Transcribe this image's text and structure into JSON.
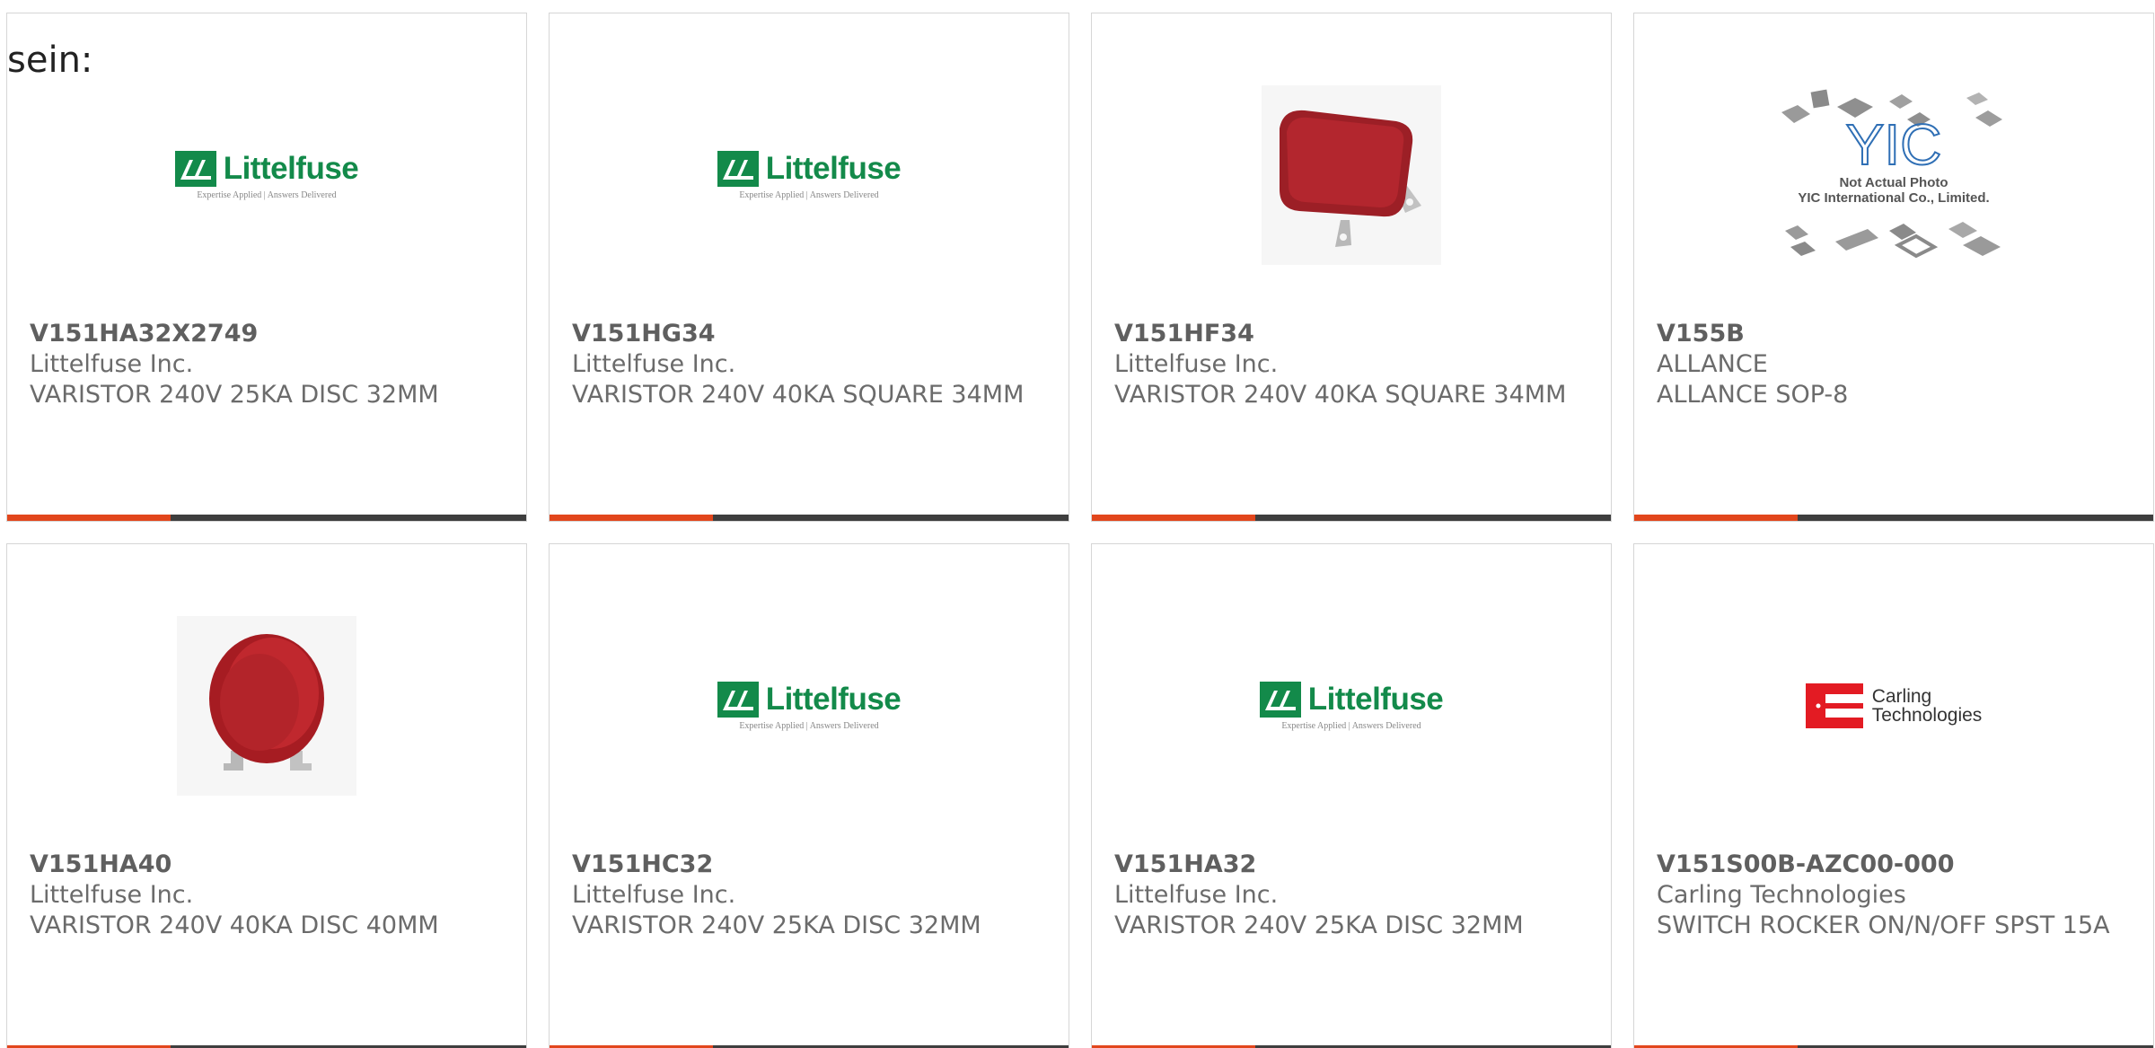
{
  "intro_text": "sein:",
  "colors": {
    "accent": "#e2461c",
    "bar": "#3e3e3e",
    "littelfuse_green": "#138a4a",
    "carling_red": "#e31b23"
  },
  "products": [
    {
      "part": "V151HA32X2749",
      "manufacturer": "Littelfuse Inc.",
      "description": "VARISTOR 240V 25KA DISC 32MM",
      "image": "littelfuse-logo"
    },
    {
      "part": "V151HG34",
      "manufacturer": "Littelfuse Inc.",
      "description": "VARISTOR 240V 40KA SQUARE 34MM",
      "image": "littelfuse-logo"
    },
    {
      "part": "V151HF34",
      "manufacturer": "Littelfuse Inc.",
      "description": "VARISTOR 240V 40KA SQUARE 34MM",
      "image": "square-varistor-photo"
    },
    {
      "part": "V155B",
      "manufacturer": "ALLANCE",
      "description": "ALLANCE SOP-8",
      "image": "yic-placeholder"
    },
    {
      "part": "V151HA40",
      "manufacturer": "Littelfuse Inc.",
      "description": "VARISTOR 240V 40KA DISC 40MM",
      "image": "disc-varistor-photo"
    },
    {
      "part": "V151HC32",
      "manufacturer": "Littelfuse Inc.",
      "description": "VARISTOR 240V 25KA DISC 32MM",
      "image": "littelfuse-logo"
    },
    {
      "part": "V151HA32",
      "manufacturer": "Littelfuse Inc.",
      "description": "VARISTOR 240V 25KA DISC 32MM",
      "image": "littelfuse-logo"
    },
    {
      "part": "V151S00B-AZC00-000",
      "manufacturer": "Carling Technologies",
      "description": "SWITCH ROCKER ON/N/OFF SPST 15A",
      "image": "carling-logo"
    }
  ],
  "logos": {
    "littelfuse_name": "Littelfuse",
    "littelfuse_tagline": "Expertise Applied | Answers Delivered",
    "carling_line1": "Carling",
    "carling_line2": "Technologies",
    "yic_mark": "YIC",
    "yic_caption1": "Not Actual Photo",
    "yic_caption2": "YIC International Co., Limited."
  }
}
